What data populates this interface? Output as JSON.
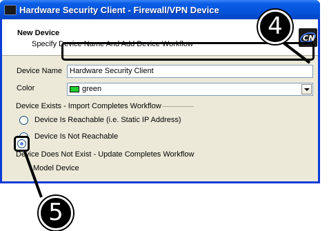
{
  "window": {
    "title": "Hardware Security Client - Firewall/VPN Device"
  },
  "header": {
    "title": "New Device",
    "subtitle": "Specify Device Name And Add Device Workflow",
    "logo_text": "CN"
  },
  "form": {
    "device_name_label": "Device Name",
    "device_name_value": "Hardware Security Client",
    "color_label": "Color",
    "color_value": "green",
    "color_swatch": "#22d02e"
  },
  "exists_group": {
    "title": "Device Exists - Import Completes Workflow",
    "options": [
      {
        "label": "Device Is Reachable (i.e. Static IP Address)",
        "selected": false
      },
      {
        "label": "Device Is Not Reachable",
        "selected": false
      }
    ]
  },
  "not_exists_group": {
    "title": "Device Does Not Exist - Update Completes Workflow",
    "options": [
      {
        "label": "Model Device",
        "selected": true
      }
    ]
  },
  "callouts": {
    "first": "4",
    "second": "5"
  }
}
